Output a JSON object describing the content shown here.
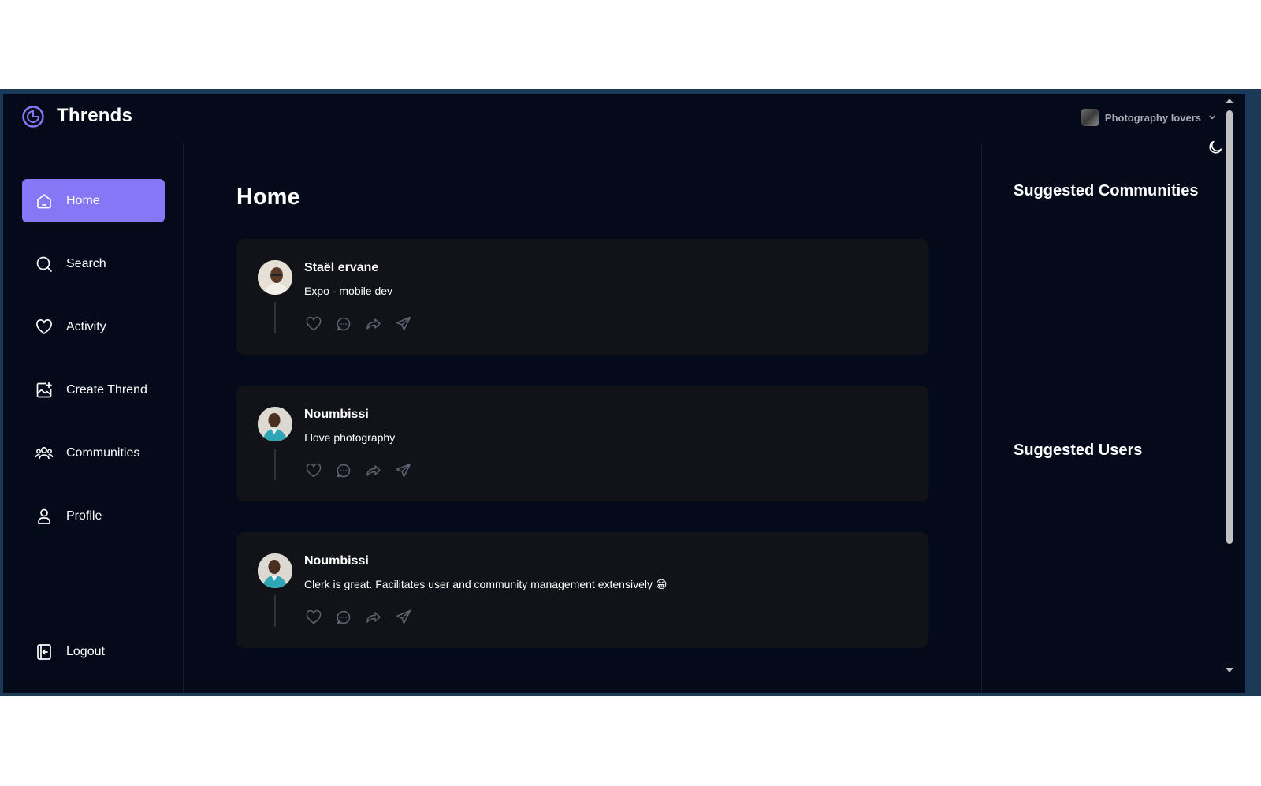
{
  "app": {
    "brand": "Thrends",
    "accent": "#8577f6",
    "background": "#050a1b",
    "card": "#121318"
  },
  "org_switcher": {
    "label": "Photography lovers",
    "icon": "chevron-down-icon"
  },
  "theme_toggle": {
    "icon": "moon-icon"
  },
  "sidebar": {
    "items": [
      {
        "label": "Home",
        "icon": "home-icon",
        "active": true
      },
      {
        "label": "Search",
        "icon": "search-icon",
        "active": false
      },
      {
        "label": "Activity",
        "icon": "heart-icon",
        "active": false
      },
      {
        "label": "Create Thrend",
        "icon": "image-plus-icon",
        "active": false
      },
      {
        "label": "Communities",
        "icon": "users-icon",
        "active": false
      },
      {
        "label": "Profile",
        "icon": "user-icon",
        "active": false
      }
    ],
    "logout": {
      "label": "Logout",
      "icon": "logout-icon"
    }
  },
  "main": {
    "title": "Home",
    "posts": [
      {
        "author": "Staël ervane",
        "text": "Expo - mobile dev"
      },
      {
        "author": "Noumbissi",
        "text": "I love photography"
      },
      {
        "author": "Noumbissi",
        "text": "Clerk is great. Facilitates user and community management extensively 😁"
      }
    ]
  },
  "rightbar": {
    "communities_title": "Suggested Communities",
    "users_title": "Suggested Users"
  }
}
